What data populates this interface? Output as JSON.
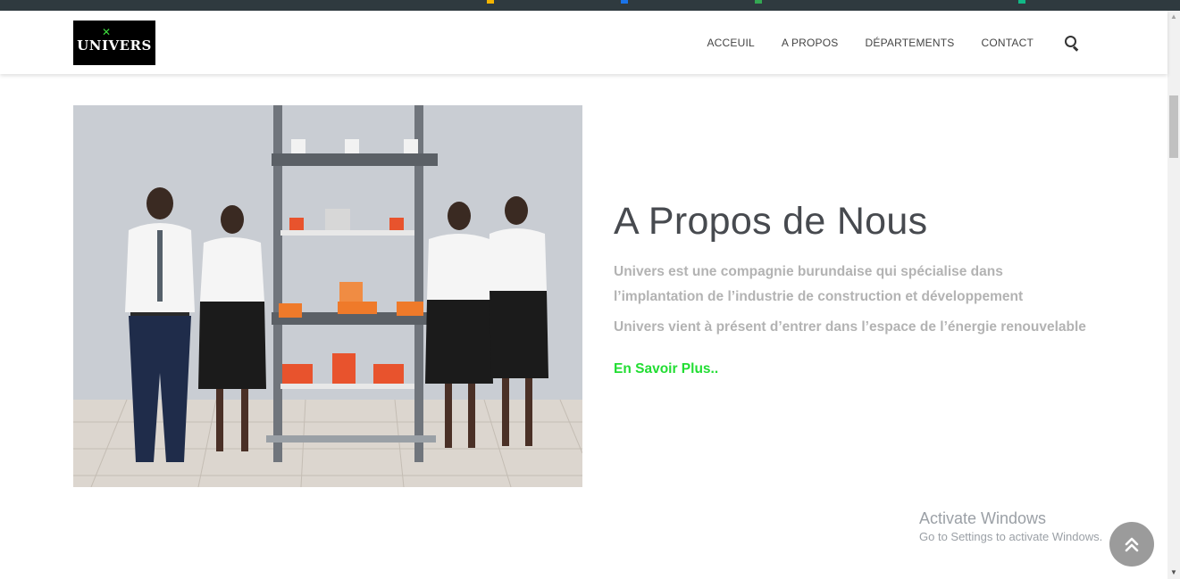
{
  "brand": {
    "logo_text": "UNIVERS",
    "logo_star": "✕"
  },
  "nav": {
    "items": [
      {
        "label": "ACCEUIL"
      },
      {
        "label": "A PROPOS"
      },
      {
        "label": "DÉPARTEMENTS"
      },
      {
        "label": "CONTACT"
      }
    ],
    "search_icon": "search-icon"
  },
  "about": {
    "title": "A Propos de Nous",
    "paragraph1": "Univers est une compagnie burundaise qui spécialise dans l’implantation de l’industrie de construction et développement",
    "paragraph2": "Univers vient à présent d’entrer dans l’espace de l’énergie renouvelable",
    "link_label": "En Savoir Plus..",
    "link_color": "#22dd33"
  },
  "overlay": {
    "activate_title": "Activate Windows",
    "activate_sub": "Go to Settings to activate Windows."
  },
  "back_to_top_icon": "double-chevron-up-icon",
  "colors": {
    "title": "#474a4f",
    "body_text": "#b3b3b3",
    "accent_green": "#22dd33"
  }
}
